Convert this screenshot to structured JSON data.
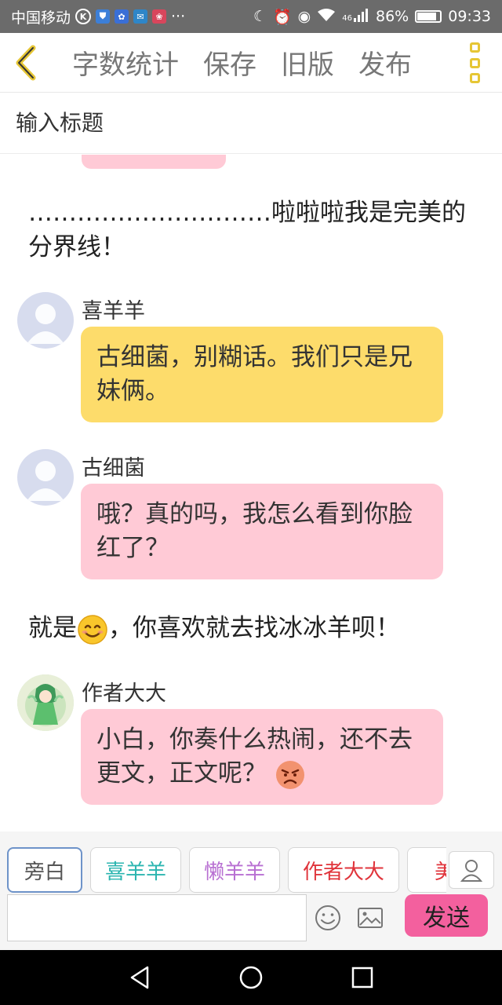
{
  "status_bar": {
    "carrier": "中国移动",
    "more": "···",
    "signal_label": "46",
    "battery_percent": "86%",
    "battery_level": 0.86,
    "time": "09:33"
  },
  "toolbar": {
    "items": [
      "字数统计",
      "保存",
      "旧版",
      "发布"
    ]
  },
  "title_input": {
    "placeholder": "输入标题",
    "value": ""
  },
  "story": {
    "divider_line": "…………………………啦啦啦我是完美的分界线！",
    "messages": [
      {
        "sender": "喜羊羊",
        "text": "古细菌，别糊话。我们只是兄妹俩。",
        "bubble_color": "#fddc6b"
      },
      {
        "sender": "古细菌",
        "text": "哦？真的吗，我怎么看到你脸红了？",
        "bubble_color": "#ffcad6"
      }
    ],
    "narration2": {
      "before": "就是",
      "after": "，你喜欢就去找冰冰羊呗！",
      "emoji": "smiling-emoji"
    },
    "author_message": {
      "sender": "作者大大",
      "text": "小白，你奏什么热闹，还不去更文，正文呢？",
      "emoji": "angry-emoji",
      "bubble_color": "#ffcad6"
    }
  },
  "roles": [
    {
      "label": "旁白",
      "color": "#555555",
      "active": true
    },
    {
      "label": "喜羊羊",
      "color": "#2bb5b0",
      "active": false
    },
    {
      "label": "懒羊羊",
      "color": "#b86fd2",
      "active": false
    },
    {
      "label": "作者大大",
      "color": "#e0353c",
      "active": false
    },
    {
      "label": "美",
      "color": "#e0353c",
      "active": false
    }
  ],
  "composer": {
    "input_value": "",
    "send_label": "发送",
    "send_color": "#f3609e"
  },
  "accent_color": "#e6c635"
}
